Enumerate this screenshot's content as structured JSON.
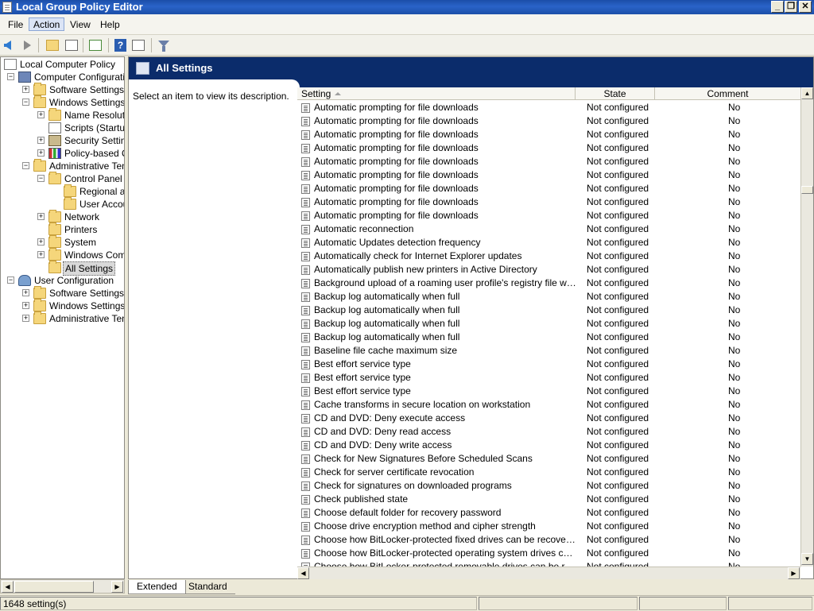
{
  "window": {
    "title": "Local Group Policy Editor",
    "controls": [
      "_",
      "❐",
      "✕"
    ]
  },
  "menu": [
    "File",
    "Action",
    "View",
    "Help"
  ],
  "tree": {
    "items": [
      {
        "label": "Local Computer Policy",
        "icon": "doc-icon",
        "level": 0,
        "expander": ""
      },
      {
        "label": "Computer Configuration",
        "icon": "computer-icon",
        "level": 1,
        "expander": "−"
      },
      {
        "label": "Software Settings",
        "icon": "folder-icon",
        "level": 2,
        "expander": "+"
      },
      {
        "label": "Windows Settings",
        "icon": "folder-icon",
        "level": 2,
        "expander": "−"
      },
      {
        "label": "Name Resolutio",
        "icon": "folder-icon",
        "level": 3,
        "expander": "+"
      },
      {
        "label": "Scripts (Startup",
        "icon": "doc-icon",
        "level": 3,
        "expander": ""
      },
      {
        "label": "Security Setting",
        "icon": "lock-icon",
        "level": 3,
        "expander": "+"
      },
      {
        "label": "Policy-based Q",
        "icon": "chart-icon",
        "level": 3,
        "expander": "+"
      },
      {
        "label": "Administrative Temp",
        "icon": "folder-icon",
        "level": 2,
        "expander": "−"
      },
      {
        "label": "Control Panel",
        "icon": "folder-icon",
        "level": 3,
        "expander": "−"
      },
      {
        "label": "Regional ar",
        "icon": "folder-icon",
        "level": 4,
        "expander": ""
      },
      {
        "label": "User Accou",
        "icon": "folder-icon",
        "level": 4,
        "expander": ""
      },
      {
        "label": "Network",
        "icon": "folder-icon",
        "level": 3,
        "expander": "+"
      },
      {
        "label": "Printers",
        "icon": "folder-icon",
        "level": 3,
        "expander": ""
      },
      {
        "label": "System",
        "icon": "folder-icon",
        "level": 3,
        "expander": "+"
      },
      {
        "label": "Windows Comp",
        "icon": "folder-icon",
        "level": 3,
        "expander": "+"
      },
      {
        "label": "All Settings",
        "icon": "folder-icon",
        "level": 3,
        "expander": "",
        "selected": true
      },
      {
        "label": "User Configuration",
        "icon": "user-icon",
        "level": 1,
        "expander": "−"
      },
      {
        "label": "Software Settings",
        "icon": "folder-icon",
        "level": 2,
        "expander": "+"
      },
      {
        "label": "Windows Settings",
        "icon": "folder-icon",
        "level": 2,
        "expander": "+"
      },
      {
        "label": "Administrative Temp",
        "icon": "folder-icon",
        "level": 2,
        "expander": "+"
      }
    ]
  },
  "pane": {
    "title": "All Settings",
    "description": "Select an item to view its description."
  },
  "columns": {
    "setting": "Setting",
    "state": "State",
    "comment": "Comment"
  },
  "rows": [
    {
      "setting": "Automatic prompting for file downloads",
      "state": "Not configured",
      "comment": "No"
    },
    {
      "setting": "Automatic prompting for file downloads",
      "state": "Not configured",
      "comment": "No"
    },
    {
      "setting": "Automatic prompting for file downloads",
      "state": "Not configured",
      "comment": "No"
    },
    {
      "setting": "Automatic prompting for file downloads",
      "state": "Not configured",
      "comment": "No"
    },
    {
      "setting": "Automatic prompting for file downloads",
      "state": "Not configured",
      "comment": "No"
    },
    {
      "setting": "Automatic prompting for file downloads",
      "state": "Not configured",
      "comment": "No"
    },
    {
      "setting": "Automatic prompting for file downloads",
      "state": "Not configured",
      "comment": "No"
    },
    {
      "setting": "Automatic prompting for file downloads",
      "state": "Not configured",
      "comment": "No"
    },
    {
      "setting": "Automatic prompting for file downloads",
      "state": "Not configured",
      "comment": "No"
    },
    {
      "setting": "Automatic reconnection",
      "state": "Not configured",
      "comment": "No"
    },
    {
      "setting": "Automatic Updates detection frequency",
      "state": "Not configured",
      "comment": "No"
    },
    {
      "setting": "Automatically check for Internet Explorer updates",
      "state": "Not configured",
      "comment": "No"
    },
    {
      "setting": "Automatically publish new printers in Active Directory",
      "state": "Not configured",
      "comment": "No"
    },
    {
      "setting": "Background upload of a roaming user profile's registry file while user...",
      "state": "Not configured",
      "comment": "No"
    },
    {
      "setting": "Backup log automatically when full",
      "state": "Not configured",
      "comment": "No"
    },
    {
      "setting": "Backup log automatically when full",
      "state": "Not configured",
      "comment": "No"
    },
    {
      "setting": "Backup log automatically when full",
      "state": "Not configured",
      "comment": "No"
    },
    {
      "setting": "Backup log automatically when full",
      "state": "Not configured",
      "comment": "No"
    },
    {
      "setting": "Baseline file cache maximum size",
      "state": "Not configured",
      "comment": "No"
    },
    {
      "setting": "Best effort service type",
      "state": "Not configured",
      "comment": "No"
    },
    {
      "setting": "Best effort service type",
      "state": "Not configured",
      "comment": "No"
    },
    {
      "setting": "Best effort service type",
      "state": "Not configured",
      "comment": "No"
    },
    {
      "setting": "Cache transforms in secure location on workstation",
      "state": "Not configured",
      "comment": "No"
    },
    {
      "setting": "CD and DVD: Deny execute access",
      "state": "Not configured",
      "comment": "No"
    },
    {
      "setting": "CD and DVD: Deny read access",
      "state": "Not configured",
      "comment": "No"
    },
    {
      "setting": "CD and DVD: Deny write access",
      "state": "Not configured",
      "comment": "No"
    },
    {
      "setting": "Check for New Signatures Before Scheduled Scans",
      "state": "Not configured",
      "comment": "No"
    },
    {
      "setting": "Check for server certificate revocation",
      "state": "Not configured",
      "comment": "No"
    },
    {
      "setting": "Check for signatures on downloaded programs",
      "state": "Not configured",
      "comment": "No"
    },
    {
      "setting": "Check published state",
      "state": "Not configured",
      "comment": "No"
    },
    {
      "setting": "Choose default folder for recovery password",
      "state": "Not configured",
      "comment": "No"
    },
    {
      "setting": "Choose drive encryption method and cipher strength",
      "state": "Not configured",
      "comment": "No"
    },
    {
      "setting": "Choose how BitLocker-protected fixed drives can be recovered",
      "state": "Not configured",
      "comment": "No"
    },
    {
      "setting": "Choose how BitLocker-protected operating system drives can be re...",
      "state": "Not configured",
      "comment": "No"
    },
    {
      "setting": "Choose how BitLocker-protected removable drives can be recovered",
      "state": "Not configured",
      "comment": "No"
    }
  ],
  "tabs": {
    "extended": "Extended",
    "standard": "Standard"
  },
  "status": {
    "text": "1648 setting(s)"
  }
}
